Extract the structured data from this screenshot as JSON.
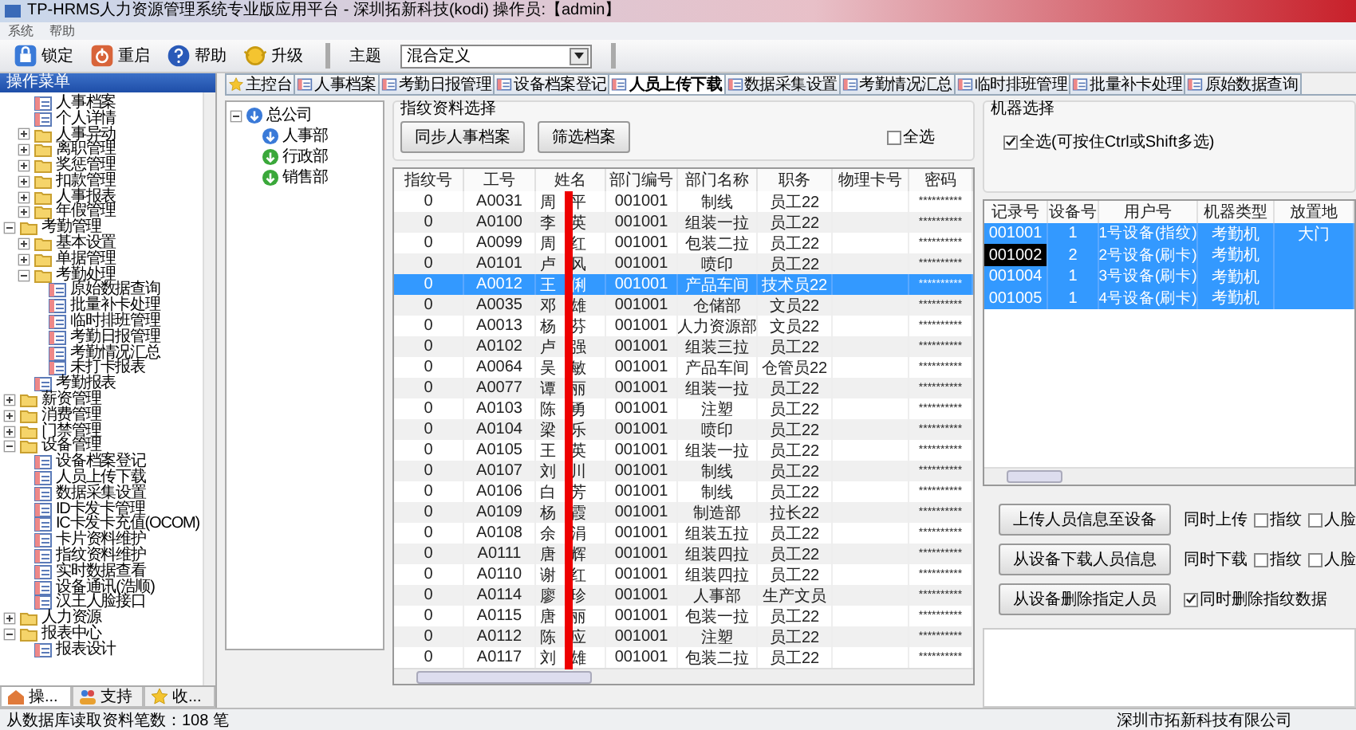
{
  "window": {
    "title": "TP-HRMS人力资源管理系统专业版应用平台 - 深圳拓新科技(kodi)  操作员:【admin】"
  },
  "menu": [
    "系统",
    "帮助"
  ],
  "toolbar": {
    "buttons": [
      {
        "label": "锁定",
        "kind": "lock"
      },
      {
        "label": "重启",
        "kind": "power"
      },
      {
        "label": "帮助",
        "kind": "help"
      },
      {
        "label": "升级",
        "kind": "upgrade"
      }
    ],
    "theme_label": "主题",
    "theme_value": "混合定义"
  },
  "sidebar": {
    "title": "操作菜单",
    "tree": [
      {
        "children": [
          {
            "label": "人事档案",
            "kind": "leaf"
          },
          {
            "label": "个人详情",
            "kind": "leaf"
          },
          {
            "label": "人事异动",
            "kind": "folder",
            "expanded": false
          },
          {
            "label": "离职管理",
            "kind": "folder",
            "expanded": false
          },
          {
            "label": "奖惩管理",
            "kind": "folder",
            "expanded": false
          },
          {
            "label": "扣款管理",
            "kind": "folder",
            "expanded": false
          },
          {
            "label": "人事报表",
            "kind": "folder",
            "expanded": false
          },
          {
            "label": "年假管理",
            "kind": "folder",
            "expanded": false
          }
        ]
      },
      {
        "label": "考勤管理",
        "kind": "folder",
        "expanded": true,
        "children": [
          {
            "label": "基本设置",
            "kind": "folder",
            "expanded": false
          },
          {
            "label": "单据管理",
            "kind": "folder",
            "expanded": false
          },
          {
            "label": "考勤处理",
            "kind": "folder",
            "expanded": true,
            "children": [
              {
                "label": "原始数据查询",
                "kind": "leaf"
              },
              {
                "label": "批量补卡处理",
                "kind": "leaf"
              },
              {
                "label": "临时排班管理",
                "kind": "leaf"
              },
              {
                "label": "考勤日报管理",
                "kind": "leaf"
              },
              {
                "label": "考勤情况汇总",
                "kind": "leaf"
              },
              {
                "label": "未打卡报表",
                "kind": "leaf"
              }
            ]
          },
          {
            "label": "考勤报表",
            "kind": "leaf"
          }
        ]
      },
      {
        "label": "薪资管理",
        "kind": "folder",
        "expanded": false
      },
      {
        "label": "消费管理",
        "kind": "folder",
        "expanded": false
      },
      {
        "label": "门禁管理",
        "kind": "folder",
        "expanded": false
      },
      {
        "label": "设备管理",
        "kind": "folder",
        "expanded": true,
        "children": [
          {
            "label": "设备档案登记",
            "kind": "leaf"
          },
          {
            "label": "人员上传下载",
            "kind": "leaf"
          },
          {
            "label": "数据采集设置",
            "kind": "leaf"
          },
          {
            "label": "ID卡发卡管理",
            "kind": "leaf"
          },
          {
            "label": "IC卡发卡充值(OCOM)",
            "kind": "leaf"
          },
          {
            "label": "卡片资料维护",
            "kind": "leaf"
          },
          {
            "label": "指纹资料维护",
            "kind": "leaf"
          },
          {
            "label": "实时数据查看",
            "kind": "leaf"
          },
          {
            "label": "设备通讯(浩顺)",
            "kind": "leaf"
          },
          {
            "label": "汉王人脸接口",
            "kind": "leaf"
          }
        ]
      },
      {
        "label": "人力资源",
        "kind": "folder",
        "expanded": false
      },
      {
        "label": "报表中心",
        "kind": "folder",
        "expanded": true,
        "children": [
          {
            "label": "报表设计",
            "kind": "leaf"
          }
        ]
      }
    ],
    "bottom_tabs": [
      {
        "label": "操...",
        "kind": "home",
        "selected": true
      },
      {
        "label": "支持",
        "kind": "people",
        "selected": false
      },
      {
        "label": "收...",
        "kind": "star",
        "selected": false
      }
    ]
  },
  "tabs": [
    {
      "label": "主控台",
      "kind": "star",
      "selected": false
    },
    {
      "label": "人事档案",
      "kind": "doc",
      "selected": false
    },
    {
      "label": "考勤日报管理",
      "kind": "doc",
      "selected": false
    },
    {
      "label": "设备档案登记",
      "kind": "doc",
      "selected": false
    },
    {
      "label": "人员上传下载",
      "kind": "doc",
      "selected": true
    },
    {
      "label": "数据采集设置",
      "kind": "doc",
      "selected": false
    },
    {
      "label": "考勤情况汇总",
      "kind": "doc",
      "selected": false
    },
    {
      "label": "临时排班管理",
      "kind": "doc",
      "selected": false
    },
    {
      "label": "批量补卡处理",
      "kind": "doc",
      "selected": false
    },
    {
      "label": "原始数据查询",
      "kind": "doc",
      "selected": false
    }
  ],
  "org_tree": {
    "label": "总公司",
    "color": "#3a7ad8",
    "expanded": true,
    "children": [
      {
        "label": "人事部",
        "color": "#3a7ad8"
      },
      {
        "label": "行政部",
        "color": "#3aa83a"
      },
      {
        "label": "销售部",
        "color": "#3aa83a"
      }
    ]
  },
  "fingerprint_selection": {
    "title": "指纹资料选择",
    "buttons": [
      "同步人事档案",
      "筛选档案"
    ],
    "select_all": {
      "label": "全选",
      "checked": false
    }
  },
  "employee_table": {
    "columns": [
      "指纹号",
      "工号",
      "姓名",
      "部门编号",
      "部门名称",
      "职务",
      "物理卡号",
      "密码"
    ],
    "rows": [
      {
        "selected": false,
        "cells": [
          "0",
          "A0031",
          "周平",
          "001001",
          "制线",
          "员工22",
          "",
          "**********"
        ]
      },
      {
        "selected": false,
        "cells": [
          "0",
          "A0100",
          "李英",
          "001001",
          "组装一拉",
          "员工22",
          "",
          "**********"
        ]
      },
      {
        "selected": false,
        "cells": [
          "0",
          "A0099",
          "周红",
          "001001",
          "包装二拉",
          "员工22",
          "",
          "**********"
        ]
      },
      {
        "selected": false,
        "cells": [
          "0",
          "A0101",
          "卢风",
          "001001",
          "喷印",
          "员工22",
          "",
          "**********"
        ]
      },
      {
        "selected": true,
        "cells": [
          "0",
          "A0012",
          "王俐",
          "001001",
          "产品车间",
          "技术员22",
          "",
          "**********"
        ]
      },
      {
        "selected": false,
        "cells": [
          "0",
          "A0035",
          "邓雄",
          "001001",
          "仓储部",
          "文员22",
          "",
          "**********"
        ]
      },
      {
        "selected": false,
        "cells": [
          "0",
          "A0013",
          "杨芬",
          "001001",
          "人力资源部",
          "文员22",
          "",
          "**********"
        ]
      },
      {
        "selected": false,
        "cells": [
          "0",
          "A0102",
          "卢强",
          "001001",
          "组装三拉",
          "员工22",
          "",
          "**********"
        ]
      },
      {
        "selected": false,
        "cells": [
          "0",
          "A0064",
          "吴敏",
          "001001",
          "产品车间",
          "仓管员22",
          "",
          "**********"
        ]
      },
      {
        "selected": false,
        "cells": [
          "0",
          "A0077",
          "谭丽",
          "001001",
          "组装一拉",
          "员工22",
          "",
          "**********"
        ]
      },
      {
        "selected": false,
        "cells": [
          "0",
          "A0103",
          "陈勇",
          "001001",
          "注塑",
          "员工22",
          "",
          "**********"
        ]
      },
      {
        "selected": false,
        "cells": [
          "0",
          "A0104",
          "梁乐",
          "001001",
          "喷印",
          "员工22",
          "",
          "**********"
        ]
      },
      {
        "selected": false,
        "cells": [
          "0",
          "A0105",
          "王英",
          "001001",
          "组装一拉",
          "员工22",
          "",
          "**********"
        ]
      },
      {
        "selected": false,
        "cells": [
          "0",
          "A0107",
          "刘川",
          "001001",
          "制线",
          "员工22",
          "",
          "**********"
        ]
      },
      {
        "selected": false,
        "cells": [
          "0",
          "A0106",
          "白芳",
          "001001",
          "制线",
          "员工22",
          "",
          "**********"
        ]
      },
      {
        "selected": false,
        "cells": [
          "0",
          "A0109",
          "杨霞",
          "001001",
          "制造部",
          "拉长22",
          "",
          "**********"
        ]
      },
      {
        "selected": false,
        "cells": [
          "0",
          "A0108",
          "余涓",
          "001001",
          "组装五拉",
          "员工22",
          "",
          "**********"
        ]
      },
      {
        "selected": false,
        "cells": [
          "0",
          "A0111",
          "唐辉",
          "001001",
          "组装四拉",
          "员工22",
          "",
          "**********"
        ]
      },
      {
        "selected": false,
        "cells": [
          "0",
          "A0110",
          "谢红",
          "001001",
          "组装四拉",
          "员工22",
          "",
          "**********"
        ]
      },
      {
        "selected": false,
        "cells": [
          "0",
          "A0114",
          "廖珍",
          "001001",
          "人事部",
          "生产文员",
          "",
          "**********"
        ]
      },
      {
        "selected": false,
        "cells": [
          "0",
          "A0115",
          "唐丽",
          "001001",
          "包装一拉",
          "员工22",
          "",
          "**********"
        ]
      },
      {
        "selected": false,
        "cells": [
          "0",
          "A0112",
          "陈应",
          "001001",
          "注塑",
          "员工22",
          "",
          "**********"
        ]
      },
      {
        "selected": false,
        "cells": [
          "0",
          "A0117",
          "刘雄",
          "001001",
          "包装二拉",
          "员工22",
          "",
          "**********"
        ]
      }
    ]
  },
  "machine_selection": {
    "title": "机器选择",
    "select_all": {
      "label": "全选(可按住Ctrl或Shift多选)",
      "checked": true
    },
    "table": {
      "columns": [
        "记录号",
        "设备号",
        "用户号",
        "机器类型",
        "放置地"
      ],
      "rows": [
        {
          "selected": true,
          "focused": false,
          "cells": [
            "001001",
            "1",
            "1号设备(指纹)",
            "考勤机",
            "大门"
          ]
        },
        {
          "selected": true,
          "focused": true,
          "cells": [
            "001002",
            "2",
            "2号设备(刷卡)",
            "考勤机",
            ""
          ]
        },
        {
          "selected": true,
          "focused": false,
          "cells": [
            "001004",
            "1",
            "3号设备(刷卡)",
            "考勤机",
            ""
          ]
        },
        {
          "selected": true,
          "focused": false,
          "cells": [
            "001005",
            "1",
            "4号设备(刷卡)",
            "考勤机",
            ""
          ]
        }
      ]
    }
  },
  "actions": [
    {
      "button": "上传人员信息至设备",
      "kind": "options",
      "label": "同时上传",
      "options": [
        {
          "label": "指纹",
          "checked": false
        },
        {
          "label": "人脸",
          "checked": false
        }
      ]
    },
    {
      "button": "从设备下载人员信息",
      "kind": "options",
      "label": "同时下载",
      "options": [
        {
          "label": "指纹",
          "checked": false
        },
        {
          "label": "人脸",
          "checked": false
        }
      ]
    },
    {
      "button": "从设备删除指定人员",
      "kind": "check",
      "options": [
        {
          "label": "同时删除指纹数据",
          "checked": true
        }
      ]
    }
  ],
  "status_bar": {
    "left": "从数据库读取资料笔数：108 笔",
    "right": "深圳市拓新科技有限公司"
  }
}
